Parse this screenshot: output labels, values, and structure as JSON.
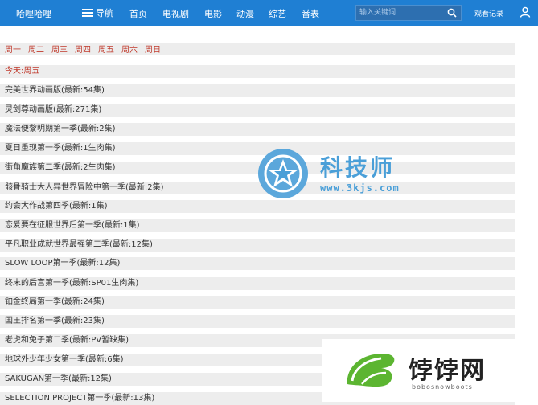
{
  "header": {
    "brand": "哈哩哈哩",
    "menu_label": "导航",
    "nav": [
      "首页",
      "电视剧",
      "电影",
      "动漫",
      "综艺",
      "番表"
    ],
    "search_placeholder": "输入关键词",
    "watch_history": "观看记录"
  },
  "week": {
    "days": [
      "周一",
      "周二",
      "周三",
      "周四",
      "周五",
      "周六",
      "周日"
    ],
    "today": "今天:周五"
  },
  "shows": [
    "完美世界动画版(最新:54集)",
    "灵剑尊动画版(最新:271集)",
    "魔法便黎明期第一季(最新:2集)",
    "夏日重现第一季(最新:1生肉集)",
    "街角魔族第二季(最新:2生肉集)",
    "骸骨骑士大人异世界冒险中第一季(最新:2集)",
    "约会大作战第四季(最新:1集)",
    "恋爱要在征服世界后第一季(最新:1集)",
    "平凡职业成就世界最强第二季(最新:12集)",
    "SLOW LOOP第一季(最新:12集)",
    "终末的后宫第一季(最新:SP01生肉集)",
    "铂金终局第一季(最新:24集)",
    "国王排名第一季(最新:23集)",
    "老虎和兔子第二季(最新:PV暂缺集)",
    "地球外少年少女第一季(最新:6集)",
    "SAKUGAN第一季(最新:12集)",
    "SELECTION PROJECT第一季(最新:13集)"
  ],
  "watermarks": {
    "center_title": "科技师",
    "center_url": "www.3kjs.com",
    "corner_title": "饽饽网",
    "corner_url": "bobosnowboots"
  },
  "colors": {
    "header_bg": "#1f7fd3",
    "row_bg": "#ededed",
    "day_link": "#c0392b",
    "watermark_blue": "#4a9fd8"
  }
}
